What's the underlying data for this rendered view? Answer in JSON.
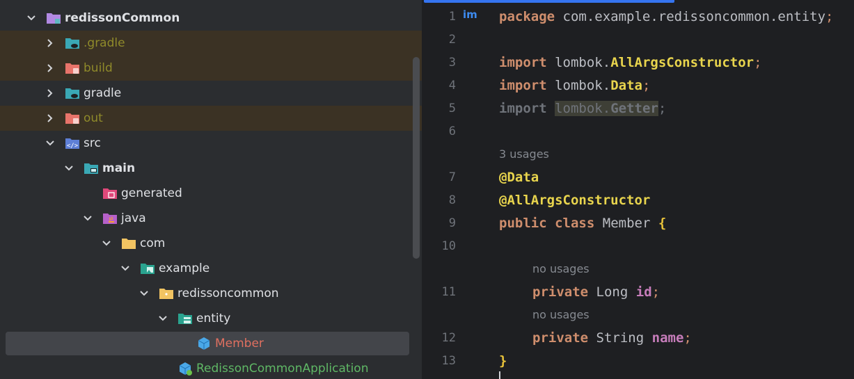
{
  "tree": {
    "items": [
      {
        "label": "redissonCommon",
        "icon": "module-folder-icon",
        "chevron": "chevron-down-icon"
      },
      {
        "label": ".gradle",
        "icon": "gradle-folder-icon",
        "chevron": "chevron-right-icon"
      },
      {
        "label": "build",
        "icon": "excluded-folder-icon",
        "chevron": "chevron-right-icon"
      },
      {
        "label": "gradle",
        "icon": "gradle-folder-icon",
        "chevron": "chevron-right-icon"
      },
      {
        "label": "out",
        "icon": "excluded-folder-icon",
        "chevron": "chevron-right-icon"
      },
      {
        "label": "src",
        "icon": "source-folder-icon",
        "chevron": "chevron-down-icon"
      },
      {
        "label": "main",
        "icon": "source-set-folder-icon",
        "chevron": "chevron-down-icon"
      },
      {
        "label": "generated",
        "icon": "generated-folder-icon"
      },
      {
        "label": "java",
        "icon": "java-folder-icon",
        "chevron": "chevron-down-icon"
      },
      {
        "label": "com",
        "icon": "package-folder-icon",
        "chevron": "chevron-down-icon"
      },
      {
        "label": "example",
        "icon": "image-folder-icon",
        "chevron": "chevron-down-icon"
      },
      {
        "label": "redissoncommon",
        "icon": "package-folder-icon",
        "chevron": "chevron-down-icon"
      },
      {
        "label": "entity",
        "icon": "entity-folder-icon",
        "chevron": "chevron-down-icon"
      },
      {
        "label": "Member",
        "icon": "class-cube-icon"
      },
      {
        "label": "RedissonCommonApplication",
        "icon": "spring-class-cube-icon"
      }
    ]
  },
  "editor": {
    "gutter_badge": "im",
    "line_numbers": [
      "1",
      "2",
      "3",
      "4",
      "5",
      "6",
      "7",
      "8",
      "9",
      "10",
      "11",
      "12",
      "13"
    ],
    "hints": {
      "class_usages": "3 usages",
      "id_usages": "no usages",
      "name_usages": "no usages"
    },
    "code": {
      "l1_kw": "package",
      "l1_pkg": "com.example.redissoncommon.entity",
      "semi": ";",
      "import_kw": "import",
      "lombok": "lombok",
      "dot": ".",
      "all_args": "AllArgsConstructor",
      "data": "Data",
      "getter": "Getter",
      "ann_data": "@Data",
      "ann_all_args": "@AllArgsConstructor",
      "public_kw": "public",
      "class_kw": "class",
      "class_name": "Member",
      "open_brace": "{",
      "close_brace": "}",
      "private_kw": "private",
      "long_type": "Long",
      "id_field": "id",
      "string_type": "String",
      "name_field": "name"
    }
  },
  "colors": {
    "tree_bg": "#2b2d30",
    "editor_bg": "#1e1f22",
    "keyword": "#cf8e6d",
    "annotation": "#e8d44d",
    "field": "#c77dbb",
    "accent": "#3574f0"
  }
}
